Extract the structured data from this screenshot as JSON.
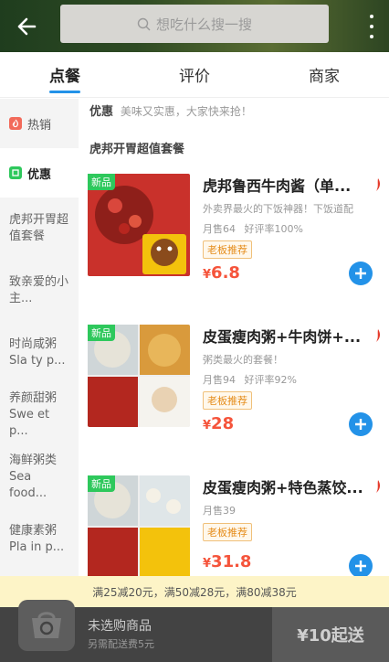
{
  "header": {
    "search_placeholder": "想吃什么搜一搜"
  },
  "tabs": [
    {
      "label": "点餐",
      "active": true
    },
    {
      "label": "评价",
      "active": false
    },
    {
      "label": "商家",
      "active": false
    }
  ],
  "sidebar": {
    "hot": "热销",
    "discount": "优惠",
    "items": [
      "虎邦开胃超值套餐",
      "致亲爱的小主...",
      "时尚咸粥 Sla ty p...",
      "养颜甜粥 Swe et p...",
      "海鲜粥类 Sea food...",
      "健康素粥 Pla in p..."
    ]
  },
  "main": {
    "promo_label": "优惠",
    "promo_text": "美味又实惠，大家快来抢！",
    "section_title": "虎邦开胃超值套餐",
    "foods": [
      {
        "tag": "新品",
        "title": "虎邦鲁西牛肉酱（单...",
        "desc": "外卖界最火的下饭神器！下饭道配",
        "sales": "月售64",
        "rating": "好评率100%",
        "badge": "老板推荐",
        "currency": "¥",
        "price": "6.8"
      },
      {
        "tag": "新品",
        "title": "皮蛋瘦肉粥+牛肉饼+...",
        "desc": "粥类最火的套餐！",
        "sales": "月售94",
        "rating": "好评率92%",
        "badge": "老板推荐",
        "currency": "¥",
        "price": "28"
      },
      {
        "tag": "新品",
        "title": "皮蛋瘦肉粥+特色蒸饺...",
        "desc": "",
        "sales": "月售39",
        "rating": "",
        "badge": "老板推荐",
        "currency": "¥",
        "price": "31.8"
      }
    ]
  },
  "discount_strip": "满25减20元，满50减28元，满80减38元",
  "cart": {
    "empty_text": "未选购商品",
    "delivery_text": "另需配送费5元",
    "checkout_label": "¥10起送"
  },
  "colors": {
    "accent": "#2392e8",
    "price": "#f5543b",
    "new_tag": "#2ec85c"
  }
}
